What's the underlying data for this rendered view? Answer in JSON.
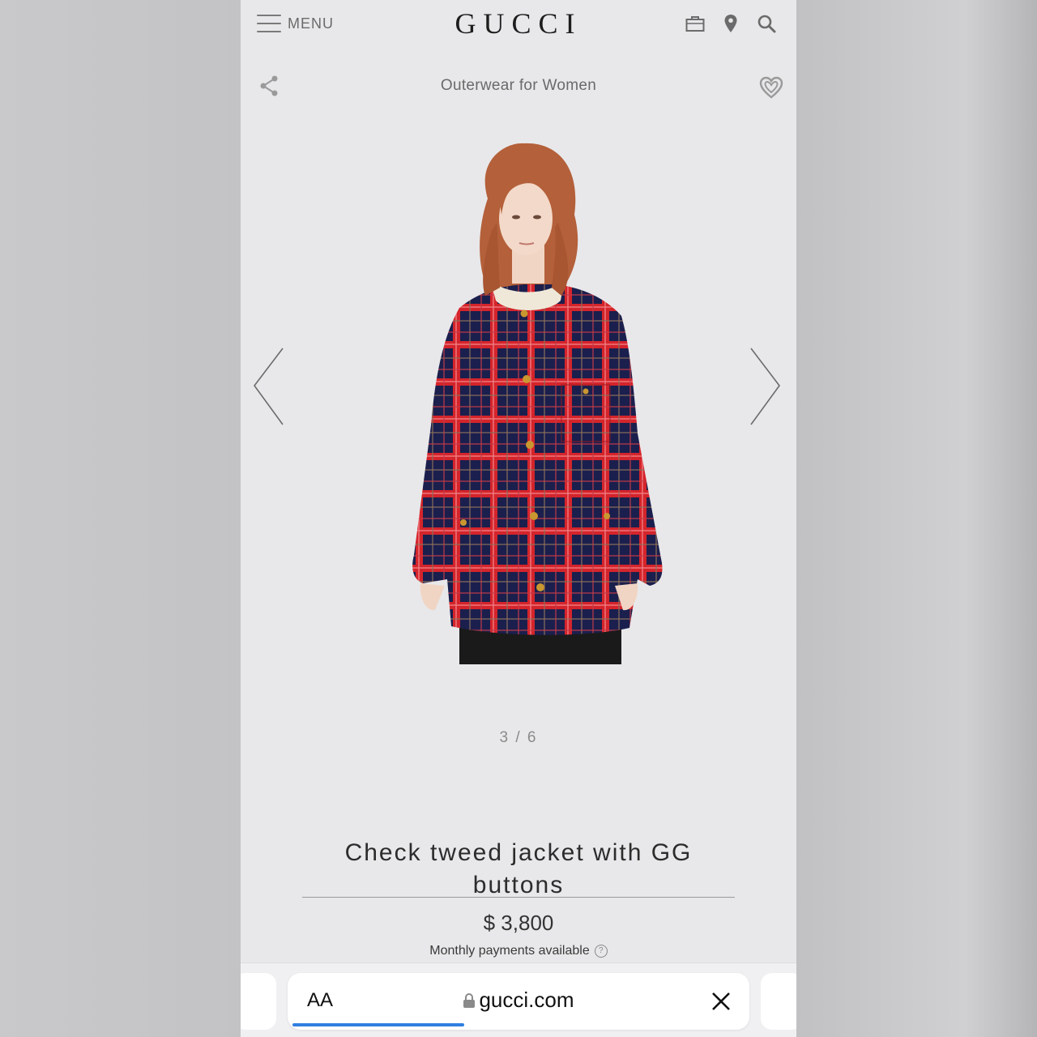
{
  "header": {
    "menu_label": "MENU",
    "logo": "GUCCI",
    "icons": [
      "shopping-bag-icon",
      "location-pin-icon",
      "search-icon"
    ]
  },
  "subheader": {
    "category": "Outerwear for Women",
    "share_icon": "share-icon",
    "wishlist_icon": "heart-icon"
  },
  "gallery": {
    "pager": "3 / 6",
    "current": 3,
    "total": 6
  },
  "product": {
    "title": "Check tweed jacket with GG buttons",
    "price": "$ 3,800",
    "monthly": "Monthly payments available"
  },
  "browser": {
    "aa_label": "AA",
    "url": "gucci.com",
    "load_progress": 0.38
  },
  "colors": {
    "page_bg": "#e8e8ea",
    "jacket_navy": "#1b1f4d",
    "jacket_red": "#d4242b",
    "progress_blue": "#2f7fe0"
  }
}
